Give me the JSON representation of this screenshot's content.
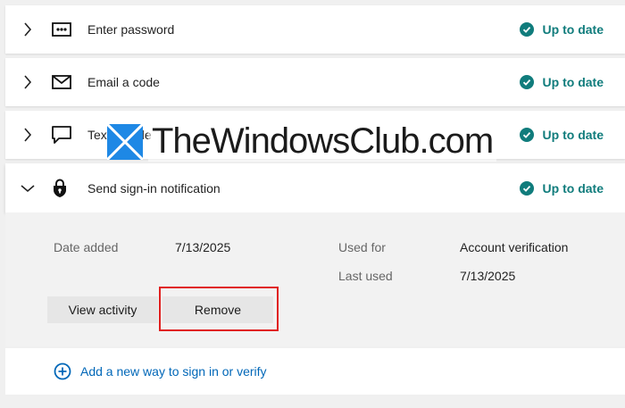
{
  "methods": [
    {
      "label": "Enter password",
      "status": "Up to date",
      "icon": "password-dots-icon",
      "expanded": false
    },
    {
      "label": "Email a code",
      "status": "Up to date",
      "icon": "envelope-icon",
      "expanded": false
    },
    {
      "label": "Text a code",
      "status": "Up to date",
      "icon": "speech-bubble-icon",
      "expanded": false
    },
    {
      "label": "Send sign-in notification",
      "status": "Up to date",
      "icon": "lock-shield-icon",
      "expanded": true
    }
  ],
  "details": {
    "date_added_label": "Date added",
    "date_added_value": "7/13/2025",
    "used_for_label": "Used for",
    "used_for_value": "Account verification",
    "last_used_label": "Last used",
    "last_used_value": "7/13/2025",
    "view_activity_label": "View activity",
    "remove_label": "Remove"
  },
  "add": {
    "label": "Add a new way to sign in or verify"
  },
  "watermark": {
    "text": "TheWindowsClub.com"
  },
  "colors": {
    "status": "#107c7c",
    "link": "#0067b8",
    "highlight": "#e0201f"
  }
}
